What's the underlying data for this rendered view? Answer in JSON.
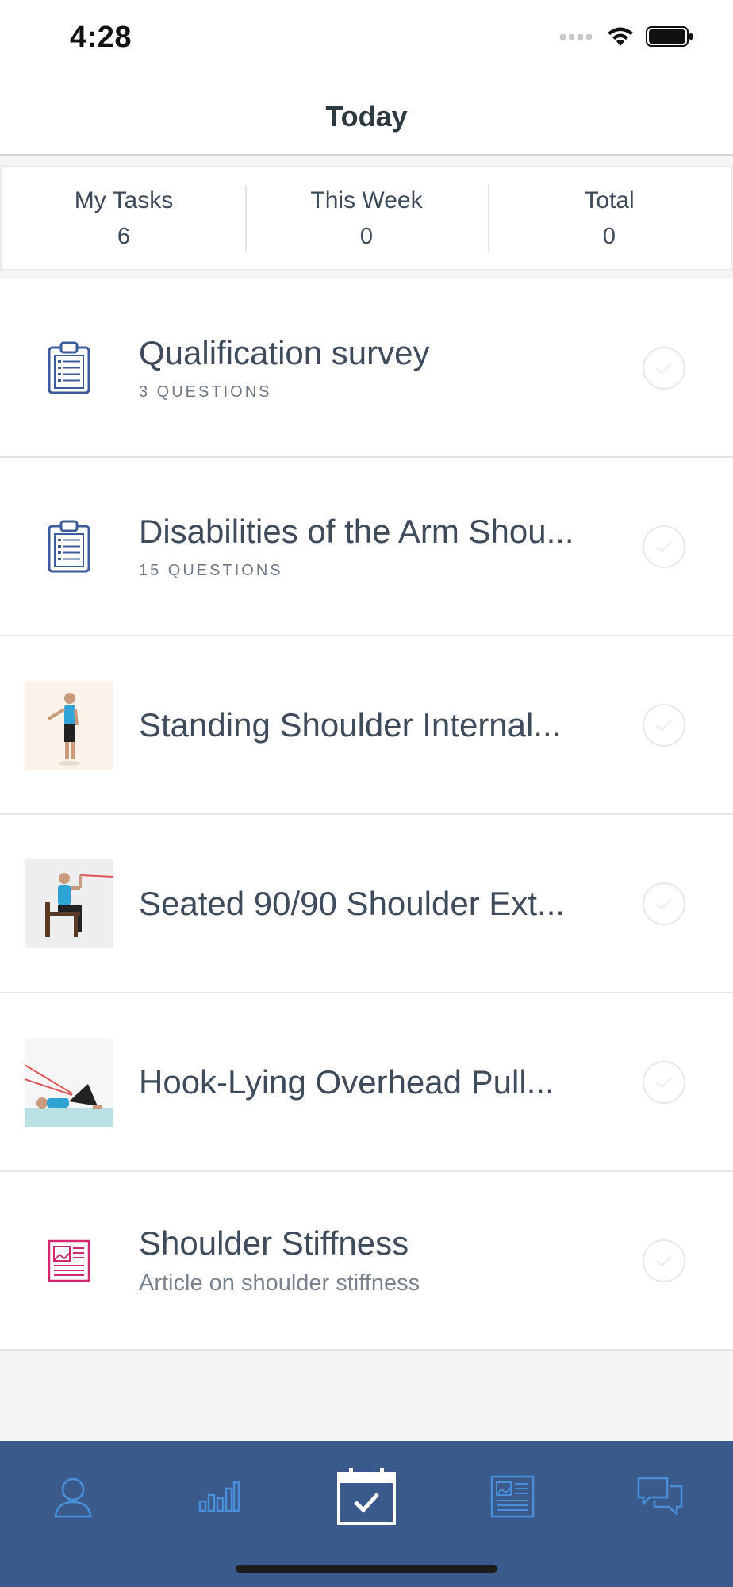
{
  "status_bar": {
    "time": "4:28"
  },
  "nav": {
    "title": "Today"
  },
  "stats": [
    {
      "label": "My Tasks",
      "value": "6"
    },
    {
      "label": "This Week",
      "value": "0"
    },
    {
      "label": "Total",
      "value": "0"
    }
  ],
  "tasks": [
    {
      "title": "Qualification survey",
      "subtitle": "3 QUESTIONS",
      "icon": "clipboard-icon"
    },
    {
      "title": "Disabilities of the Arm Shou...",
      "subtitle": "15 QUESTIONS",
      "icon": "clipboard-icon"
    },
    {
      "title": "Standing Shoulder Internal...",
      "icon": "exercise-photo"
    },
    {
      "title": "Seated 90/90 Shoulder Ext...",
      "icon": "exercise-photo"
    },
    {
      "title": "Hook-Lying Overhead Pull...",
      "icon": "exercise-photo"
    },
    {
      "title": "Shoulder Stiffness",
      "subtitle": "Article on shoulder stiffness",
      "icon": "article-icon"
    }
  ],
  "tab_bar": {
    "items": [
      "profile-icon",
      "chart-icon",
      "calendar-check-icon",
      "article-icon",
      "chat-icon"
    ],
    "active": "calendar-check-icon"
  },
  "colors": {
    "tab_bar_bg": "#3a5a8c",
    "tab_icon": "#4a90d9",
    "clipboard_icon": "#3b5b9a",
    "article_icon": "#d0286e",
    "text": "#3f4a5a"
  }
}
